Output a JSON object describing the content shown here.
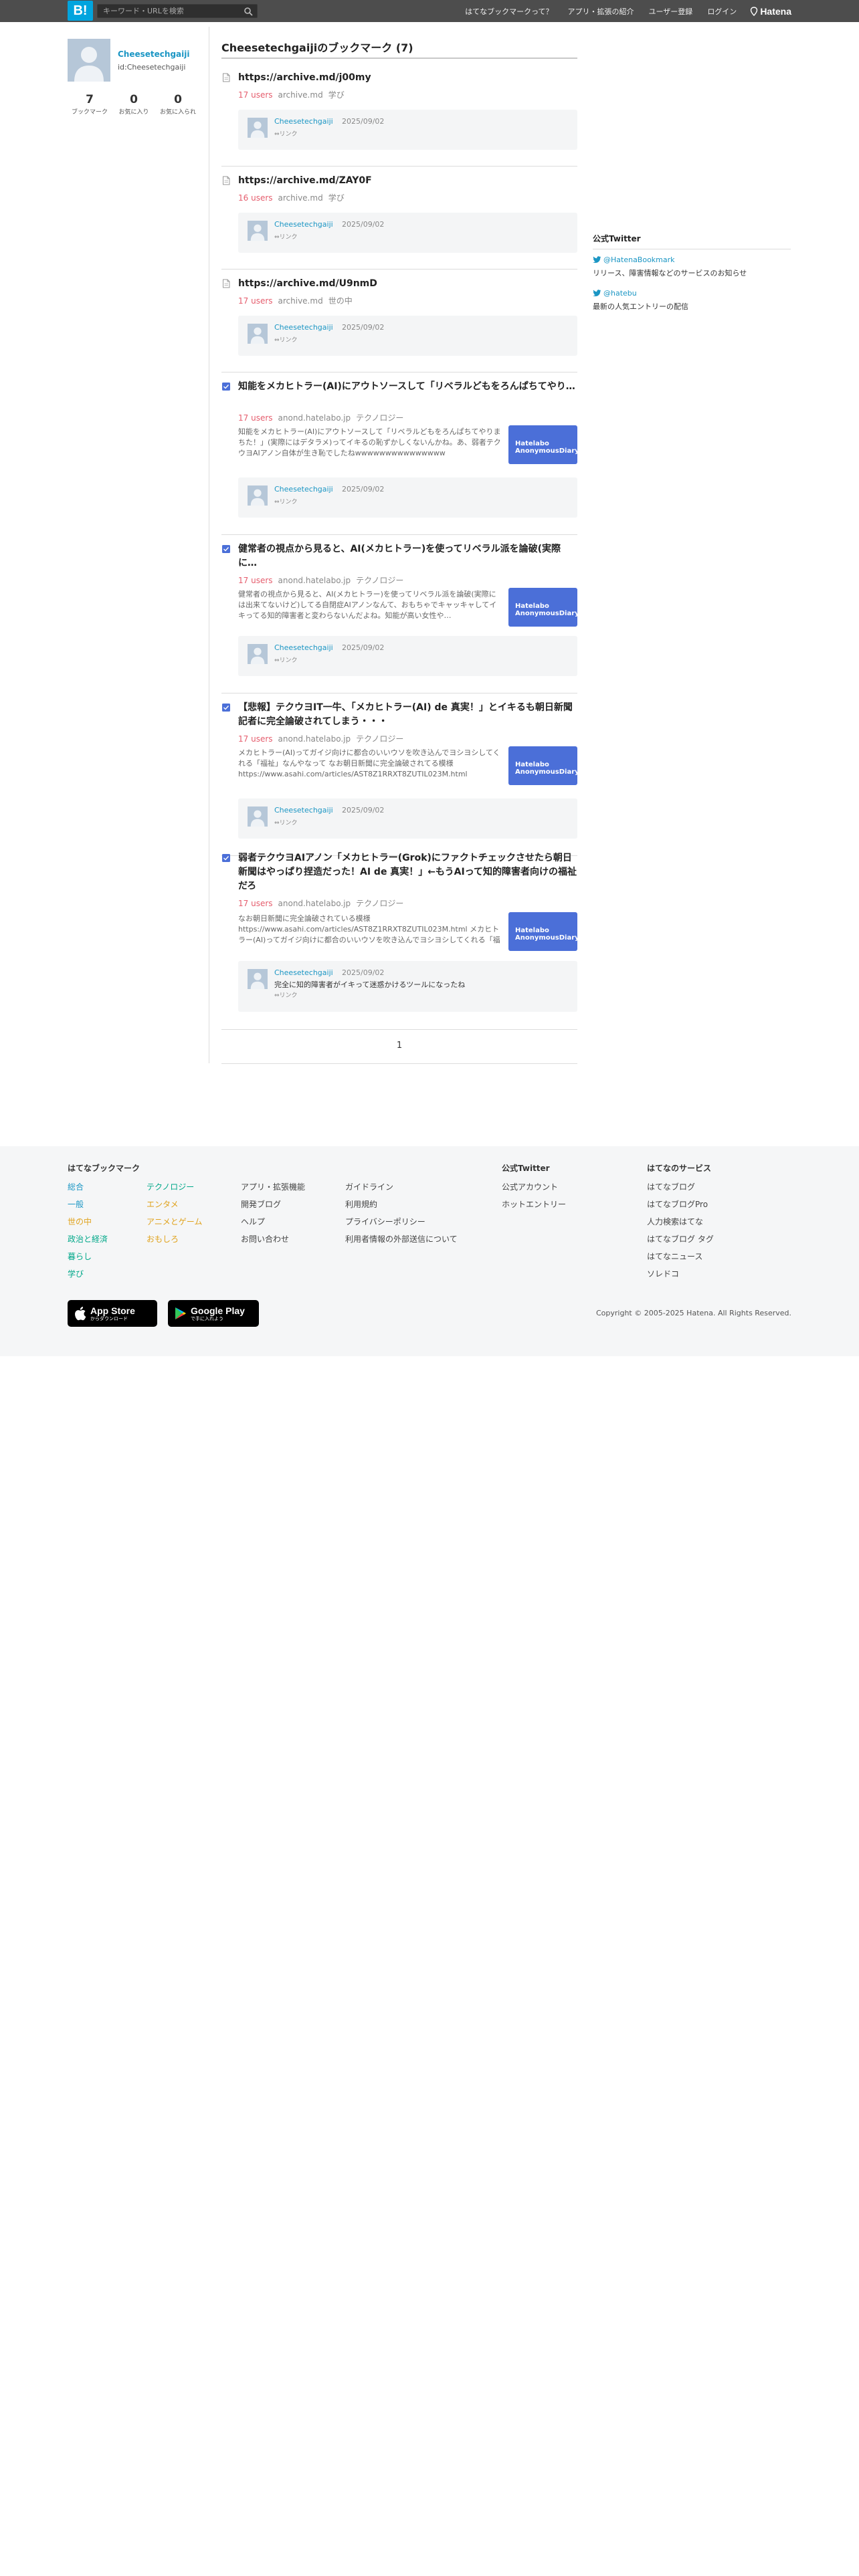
{
  "header": {
    "logo": "B!",
    "search_placeholder": "キーワード・URLを検索",
    "nav": [
      "はてなブックマークって？",
      "アプリ・拡張の紹介",
      "ユーザー登録",
      "ログイン"
    ],
    "brand": "Hatena"
  },
  "profile": {
    "name": "Cheesetechgaiji",
    "id": "id:Cheesetechgaiji",
    "stats": [
      {
        "num": "7",
        "label": "ブックマーク"
      },
      {
        "num": "0",
        "label": "お気に入り"
      },
      {
        "num": "0",
        "label": "お気に入られ"
      }
    ]
  },
  "main": {
    "title": "Cheesetechgaijiのブックマーク (7)",
    "entries": [
      {
        "icon": "document-icon",
        "title": "https://archive.md/j00my",
        "users": "17 users",
        "domain": "archive.md",
        "category": "学び",
        "comment": {
          "user": "Cheesetechgaiji",
          "date": "2025/09/02",
          "text": "",
          "link": "リンク"
        }
      },
      {
        "icon": "document-icon",
        "title": "https://archive.md/ZAY0F",
        "users": "16 users",
        "domain": "archive.md",
        "category": "学び",
        "comment": {
          "user": "Cheesetechgaiji",
          "date": "2025/09/02",
          "text": "",
          "link": "リンク"
        }
      },
      {
        "icon": "document-icon",
        "title": "https://archive.md/U9nmD",
        "users": "17 users",
        "domain": "archive.md",
        "category": "世の中",
        "comment": {
          "user": "Cheesetechgaiji",
          "date": "2025/09/02",
          "text": "",
          "link": "リンク"
        }
      },
      {
        "icon": "favicon-icon",
        "title": "知能をメカヒトラー(AI)にアウトソースして「リベラルどもをろんぱちてやり…",
        "users": "17 users",
        "domain": "anond.hatelabo.jp",
        "category": "テクノロジー",
        "desc": "知能をメカヒトラー(AI)にアウトソースして「リベラルどもをろんぱちてやりまちた！」(実際にはデタラメ)ってイキるの恥ずかしくないんかね。あ、弱者テクウヨAIアノン自体が生き恥でしたねwwwwwwwwwwwwwww",
        "thumb": "Hatelabo\nAnonymousDiary",
        "comment": {
          "user": "Cheesetechgaiji",
          "date": "2025/09/02",
          "text": "",
          "link": "リンク"
        }
      },
      {
        "icon": "favicon-icon",
        "title": "健常者の視点から見ると、AI(メカヒトラー)を使ってリベラル派を論破(実際に…",
        "users": "17 users",
        "domain": "anond.hatelabo.jp",
        "category": "テクノロジー",
        "desc": "健常者の視点から見ると、AI(メカヒトラー)を使ってリベラル派を論破(実際には出来てないけど)してる自閉症AIアノンなんて、おもちゃでキャッキャしてイキってる知的障害者と変わらないんだよね。知能が高い女性や…",
        "thumb": "Hatelabo\nAnonymousDiary",
        "comment": {
          "user": "Cheesetechgaiji",
          "date": "2025/09/02",
          "text": "",
          "link": "リンク"
        }
      },
      {
        "icon": "favicon-icon",
        "title": "【悲報】テクウヨIT一牛、「メカヒトラー(AI) de 真実！」とイキるも朝日新聞記者に完全論破されてしまう・・・",
        "users": "17 users",
        "domain": "anond.hatelabo.jp",
        "category": "テクノロジー",
        "desc": "メカヒトラー(AI)ってガイジ向けに都合のいいウソを吹き込んでヨシヨシしてくれる「福祉」なんやなって なお朝日新聞に完全論破されてる模様 https://www.asahi.com/articles/AST8Z1RRXT8ZUTIL023M.html",
        "thumb": "Hatelabo\nAnonymousDiary",
        "comment": {
          "user": "Cheesetechgaiji",
          "date": "2025/09/02",
          "text": "",
          "link": "リンク"
        }
      },
      {
        "icon": "favicon-icon",
        "title": "弱者テクウヨAIアノン「メカヒトラー(Grok)にファクトチェックさせたら朝日新聞はやっぱり捏造だった！AI de 真実！」←もうAIって知的障害者向けの福祉だろ",
        "users": "17 users",
        "domain": "anond.hatelabo.jp",
        "category": "テクノロジー",
        "desc": "なお朝日新聞に完全論破されている模様 https://www.asahi.com/articles/AST8Z1RRXT8ZUTIL023M.html メカヒトラー(AI)ってガイジ向けに都合のいいウソを吹き込んでヨシヨシしてくれる「福祉」なんやな…",
        "thumb": "Hatelabo\nAnonymousDiary",
        "comment": {
          "user": "Cheesetechgaiji",
          "date": "2025/09/02",
          "text": "完全に知的障害者がイキって迷惑かけるツールになったね",
          "link": "リンク"
        }
      }
    ],
    "pager": "1"
  },
  "side": {
    "title": "公式Twitter",
    "links": [
      {
        "handle": "@HatenaBookmark",
        "desc": "リリース、障害情報などのサービスのお知らせ"
      },
      {
        "handle": "@hatebu",
        "desc": "最新の人気エントリーの配信"
      }
    ]
  },
  "footer": {
    "brand_title": "はてなブックマーク",
    "cat_col1": [
      "総合",
      "一般",
      "世の中",
      "政治と経済",
      "暮らし",
      "学び"
    ],
    "cat_col2": [
      "テクノロジー",
      "エンタメ",
      "アニメとゲーム",
      "おもしろ"
    ],
    "misc_col1": [
      "アプリ・拡張機能",
      "開発ブログ",
      "ヘルプ",
      "お問い合わせ"
    ],
    "misc_col2": [
      "ガイドライン",
      "利用規約",
      "プライバシーポリシー",
      "利用者情報の外部送信について"
    ],
    "twitter_title": "公式Twitter",
    "twitter_links": [
      "公式アカウント",
      "ホットエントリー"
    ],
    "services_title": "はてなのサービス",
    "services": [
      "はてなブログ",
      "はてなブログPro",
      "人力検索はてな",
      "はてなブログ タグ",
      "はてなニュース",
      "ソレドコ"
    ],
    "appstore": {
      "name": "App Store",
      "sub": "からダウンロード"
    },
    "googleplay": {
      "name": "Google Play",
      "sub": "で手に入れよう"
    },
    "copyright": "Copyright © 2005-2025 Hatena. All Rights Reserved."
  },
  "colors": {
    "header_bg": "#4d4d4d",
    "logo_bg": "#00a4de",
    "link_blue": "#1b96c4",
    "users_red": "#e55d6d",
    "footer_bg": "#f5f6f7"
  }
}
